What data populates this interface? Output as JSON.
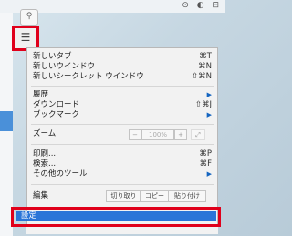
{
  "menu_button_icon": "hamburger-menu-icon",
  "menu": {
    "new_tab": {
      "label": "新しいタブ",
      "shortcut": "⌘T"
    },
    "new_window": {
      "label": "新しいウインドウ",
      "shortcut": "⌘N"
    },
    "new_incognito": {
      "label": "新しいシークレット ウインドウ",
      "shortcut": "⇧⌘N"
    },
    "history": {
      "label": "履歴"
    },
    "downloads": {
      "label": "ダウンロード",
      "shortcut": "⇧⌘J"
    },
    "bookmarks": {
      "label": "ブックマーク"
    },
    "zoom": {
      "label": "ズーム",
      "minus": "−",
      "value": "100%",
      "plus": "+"
    },
    "print": {
      "label": "印刷...",
      "shortcut": "⌘P"
    },
    "find": {
      "label": "検索...",
      "shortcut": "⌘F"
    },
    "more_tools": {
      "label": "その他のツール"
    },
    "edit": {
      "label": "編集",
      "cut": "切り取り",
      "copy": "コピー",
      "paste": "貼り付け"
    },
    "settings": {
      "label": "設定"
    }
  },
  "colors": {
    "highlight": "#e0001b",
    "selection": "#2a75d8"
  }
}
